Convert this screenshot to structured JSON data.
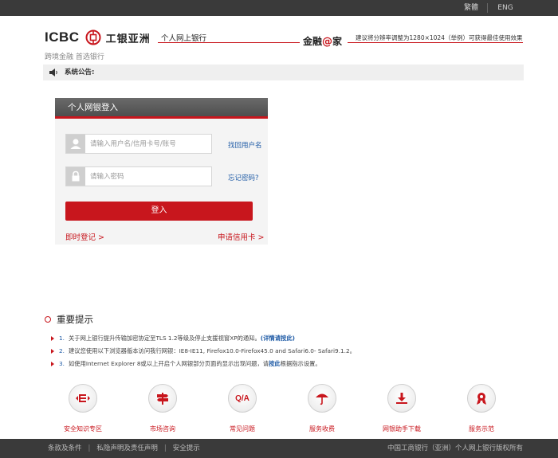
{
  "topbar": {
    "lang_traditional": "繁體",
    "lang_english": "ENG"
  },
  "header": {
    "logo_text": "ICBC",
    "logo_cn": "工银亚洲",
    "slogan": "跨境金融 首选银行",
    "personal_banking": "个人网上银行",
    "jinrong_prefix": "金融",
    "jinrong_at": "@",
    "jinrong_suffix": "家",
    "resolution_tip": "建议将分辨率调整为1280×1024（举例）可获得最佳使用效果"
  },
  "notice": {
    "label": "系统公告:"
  },
  "login": {
    "title": "个人网银登入",
    "username_placeholder": "请输入用户名/信用卡号/账号",
    "password_placeholder": "请输入密码",
    "retrieve_username": "找回用户名",
    "forgot_password": "忘记密码?",
    "submit_label": "登入",
    "register_now": "即时登记 >",
    "apply_card": "申请信用卡 >"
  },
  "important": {
    "title": "重要提示",
    "items": [
      {
        "num": "1.",
        "text": "关于网上银行提升传输加密协定至TLS 1.2等级及停止支援视窗XP的通知。",
        "link": "(详情请按此)"
      },
      {
        "num": "2.",
        "text": "建议您使用以下浏览器版本访问我行网银：IE8-IE11, Firefox10.0-Firefox45.0 and Safari6.0- Safari9.1.2。",
        "link": ""
      },
      {
        "num": "3.",
        "text": "如使用Internet Explorer 8或以上开启个人网银部分页面的显示出现问题，请",
        "link": "按此",
        "tail": "根据指示设置。"
      }
    ]
  },
  "services": [
    {
      "label": "安全知识专区",
      "icon": "security-knowledge-icon"
    },
    {
      "label": "市场咨询",
      "icon": "signpost-icon"
    },
    {
      "label": "常见问题",
      "icon": "qa-icon"
    },
    {
      "label": "服务收费",
      "icon": "umbrella-icon"
    },
    {
      "label": "网银助手下载",
      "icon": "download-icon"
    },
    {
      "label": "服务示范",
      "icon": "demo-ribbon-icon"
    }
  ],
  "footer": {
    "terms": "条款及条件",
    "privacy": "私隐声明及责任声明",
    "security": "安全提示",
    "copyright": "中国工商银行（亚洲）个人网上银行版权所有"
  },
  "colors": {
    "brand_red": "#c8161d",
    "link_blue": "#1f5ba6",
    "dark_bar": "#3a3a3a"
  }
}
